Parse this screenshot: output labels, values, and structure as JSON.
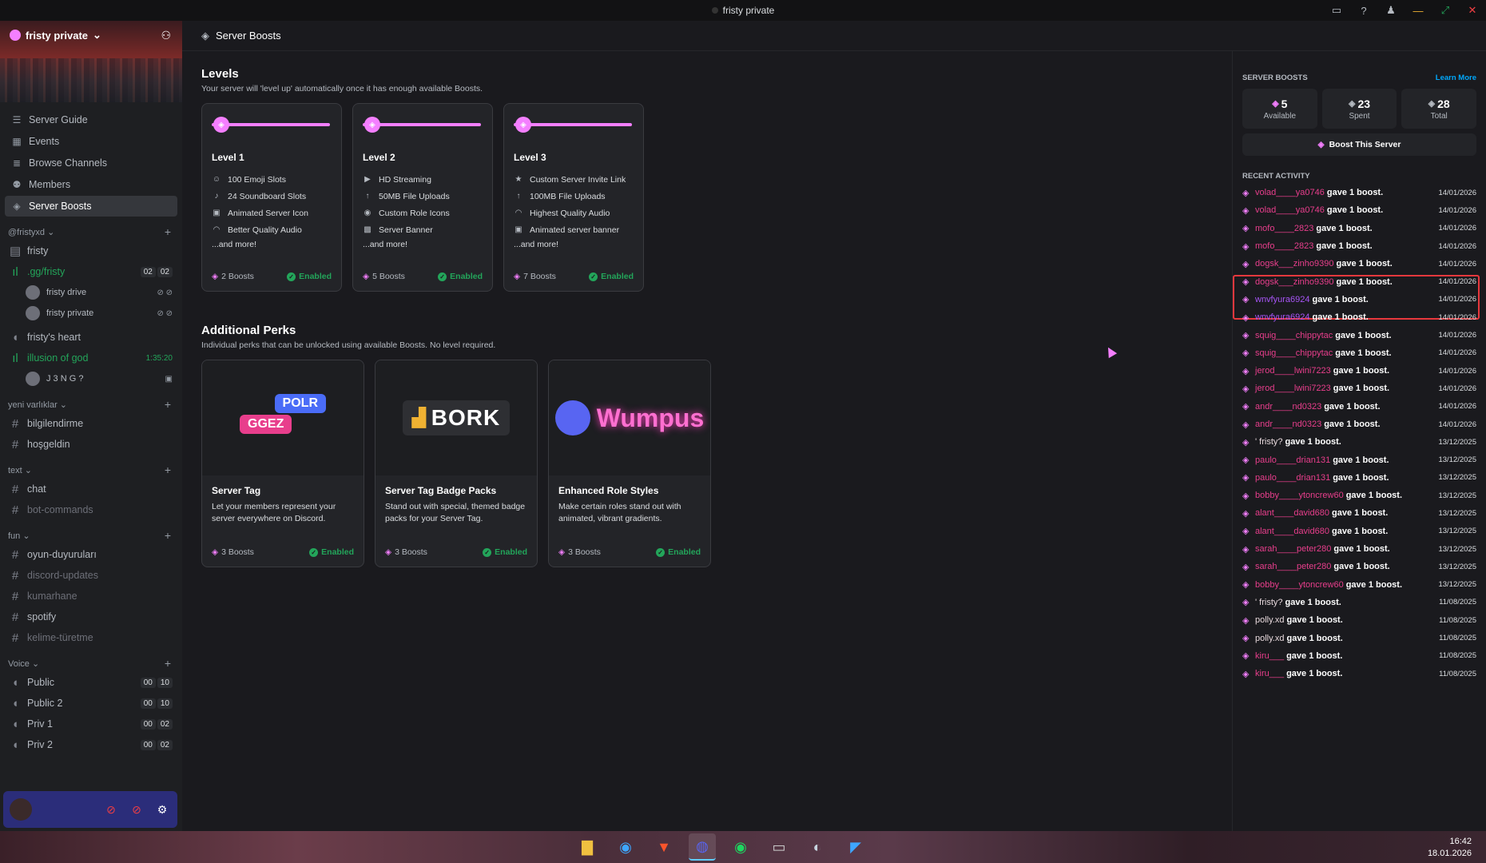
{
  "window": {
    "title": "fristy private"
  },
  "sidebar": {
    "server_name": "fristy private",
    "nav": [
      {
        "label": "Server Guide",
        "icon": "guide-icon"
      },
      {
        "label": "Events",
        "icon": "calendar-icon"
      },
      {
        "label": "Browse Channels",
        "icon": "browse-icon"
      },
      {
        "label": "Members",
        "icon": "members-icon"
      },
      {
        "label": "Server Boosts",
        "icon": "boost-icon"
      }
    ],
    "cat_fristyxd": "@fristyxd",
    "ch_fristy": "fristy",
    "ch_gg": ".gg/fristy",
    "gg_counts": [
      "02",
      "02"
    ],
    "u1": "fristy drive",
    "u2": "fristy private",
    "ch_heart": "fristy's heart",
    "ch_illusion": "illusion of god",
    "illusion_timer": "1:35:20",
    "u3": "J 3 N G ?",
    "cat_yeni": "yeni varlıklar",
    "ch_bilgi": "bilgilendirme",
    "ch_hos": "hoşgeldin",
    "cat_text": "text",
    "ch_chat": "chat",
    "ch_bot": "bot-commands",
    "cat_fun": "fun",
    "ch_oyun": "oyun-duyuruları",
    "ch_discord": "discord-updates",
    "ch_kumar": "kumarhane",
    "ch_spotify": "spotify",
    "ch_kelime": "kelime-türetme",
    "cat_voice": "Voice",
    "voice": [
      {
        "label": "Public",
        "a": "00",
        "b": "10"
      },
      {
        "label": "Public 2",
        "a": "00",
        "b": "10"
      },
      {
        "label": "Priv 1",
        "a": "00",
        "b": "02"
      },
      {
        "label": "Priv 2",
        "a": "00",
        "b": "02"
      }
    ]
  },
  "header": {
    "title": "Server Boosts"
  },
  "levels": {
    "title": "Levels",
    "subtitle": "Your server will 'level up' automatically once it has enough available Boosts.",
    "items": [
      {
        "name": "Level 1",
        "perks": [
          "100 Emoji Slots",
          "24 Soundboard Slots",
          "Animated Server Icon",
          "Better Quality Audio"
        ],
        "more": "...and more!",
        "boosts": "2 Boosts",
        "status": "Enabled"
      },
      {
        "name": "Level 2",
        "perks": [
          "HD Streaming",
          "50MB File Uploads",
          "Custom Role Icons",
          "Server Banner"
        ],
        "more": "...and more!",
        "boosts": "5 Boosts",
        "status": "Enabled"
      },
      {
        "name": "Level 3",
        "perks": [
          "Custom Server Invite Link",
          "100MB File Uploads",
          "Highest Quality Audio",
          "Animated server banner"
        ],
        "more": "...and more!",
        "boosts": "7 Boosts",
        "status": "Enabled"
      }
    ]
  },
  "perks": {
    "title": "Additional Perks",
    "subtitle": "Individual perks that can be unlocked using available Boosts. No level required.",
    "items": [
      {
        "name": "Server Tag",
        "desc": "Let your members represent your server everywhere on Discord.",
        "boosts": "3 Boosts",
        "status": "Enabled",
        "art1": "POLR",
        "art2": "GGEZ"
      },
      {
        "name": "Server Tag Badge Packs",
        "desc": "Stand out with special, themed badge packs for your Server Tag.",
        "boosts": "3 Boosts",
        "status": "Enabled",
        "art1": "BORK"
      },
      {
        "name": "Enhanced Role Styles",
        "desc": "Make certain roles stand out with animated, vibrant gradients.",
        "boosts": "3 Boosts",
        "status": "Enabled",
        "art1": "Wumpus"
      }
    ]
  },
  "right": {
    "title": "SERVER BOOSTS",
    "learn": "Learn More",
    "stats": [
      {
        "num": "5",
        "label": "Available"
      },
      {
        "num": "23",
        "label": "Spent"
      },
      {
        "num": "28",
        "label": "Total"
      }
    ],
    "boost_btn": "Boost This Server",
    "recent": "RECENT ACTIVITY",
    "activity": [
      {
        "who": "volad____ya0746",
        "what": "gave 1 boost.",
        "date": "14/01/2026",
        "c": "pink"
      },
      {
        "who": "volad____ya0746",
        "what": "gave 1 boost.",
        "date": "14/01/2026",
        "c": "pink"
      },
      {
        "who": "mofo____2823",
        "what": "gave 1 boost.",
        "date": "14/01/2026",
        "c": "pink"
      },
      {
        "who": "mofo____2823",
        "what": "gave 1 boost.",
        "date": "14/01/2026",
        "c": "pink"
      },
      {
        "who": "dogsk___zinho9390",
        "what": "gave 1 boost.",
        "date": "14/01/2026",
        "c": "pink"
      },
      {
        "who": "dogsk___zinho9390",
        "what": "gave 1 boost.",
        "date": "14/01/2026",
        "c": "pink"
      },
      {
        "who": "wnvfyura6924",
        "what": "gave 1 boost.",
        "date": "14/01/2026",
        "c": "violet"
      },
      {
        "who": "wnvfyura6924",
        "what": "gave 1 boost.",
        "date": "14/01/2026",
        "c": "violet"
      },
      {
        "who": "squig____chippytac",
        "what": "gave 1 boost.",
        "date": "14/01/2026",
        "c": "pink"
      },
      {
        "who": "squig____chippytac",
        "what": "gave 1 boost.",
        "date": "14/01/2026",
        "c": "pink"
      },
      {
        "who": "jerod____lwini7223",
        "what": "gave 1 boost.",
        "date": "14/01/2026",
        "c": "pink"
      },
      {
        "who": "jerod____lwini7223",
        "what": "gave 1 boost.",
        "date": "14/01/2026",
        "c": "pink"
      },
      {
        "who": "andr____nd0323",
        "what": "gave 1 boost.",
        "date": "14/01/2026",
        "c": "pink"
      },
      {
        "who": "andr____nd0323",
        "what": "gave 1 boost.",
        "date": "14/01/2026",
        "c": "pink"
      },
      {
        "who": "' fristy?",
        "what": "gave 1 boost.",
        "date": "13/12/2025",
        "c": "normal"
      },
      {
        "who": "paulo____drian131",
        "what": "gave 1 boost.",
        "date": "13/12/2025",
        "c": "pink"
      },
      {
        "who": "paulo____drian131",
        "what": "gave 1 boost.",
        "date": "13/12/2025",
        "c": "pink"
      },
      {
        "who": "bobby____ytoncrew60",
        "what": "gave 1 boost.",
        "date": "13/12/2025",
        "c": "pink"
      },
      {
        "who": "alant____david680",
        "what": "gave 1 boost.",
        "date": "13/12/2025",
        "c": "pink"
      },
      {
        "who": "alant____david680",
        "what": "gave 1 boost.",
        "date": "13/12/2025",
        "c": "pink"
      },
      {
        "who": "sarah____peter280",
        "what": "gave 1 boost.",
        "date": "13/12/2025",
        "c": "pink"
      },
      {
        "who": "sarah____peter280",
        "what": "gave 1 boost.",
        "date": "13/12/2025",
        "c": "pink"
      },
      {
        "who": "bobby____ytoncrew60",
        "what": "gave 1 boost.",
        "date": "13/12/2025",
        "c": "pink"
      },
      {
        "who": "' fristy?",
        "what": "gave 1 boost.",
        "date": "11/08/2025",
        "c": "normal"
      },
      {
        "who": "polly.xd",
        "what": "gave 1 boost.",
        "date": "11/08/2025",
        "c": "normal"
      },
      {
        "who": "polly.xd",
        "what": "gave 1 boost.",
        "date": "11/08/2025",
        "c": "normal"
      },
      {
        "who": "kiru___",
        "what": "gave 1 boost.",
        "date": "11/08/2025",
        "c": "pink"
      },
      {
        "who": "kiru___",
        "what": "gave 1 boost.",
        "date": "11/08/2025",
        "c": "pink"
      }
    ]
  },
  "taskbar": {
    "time": "16:42",
    "date": "18.01.2026"
  }
}
